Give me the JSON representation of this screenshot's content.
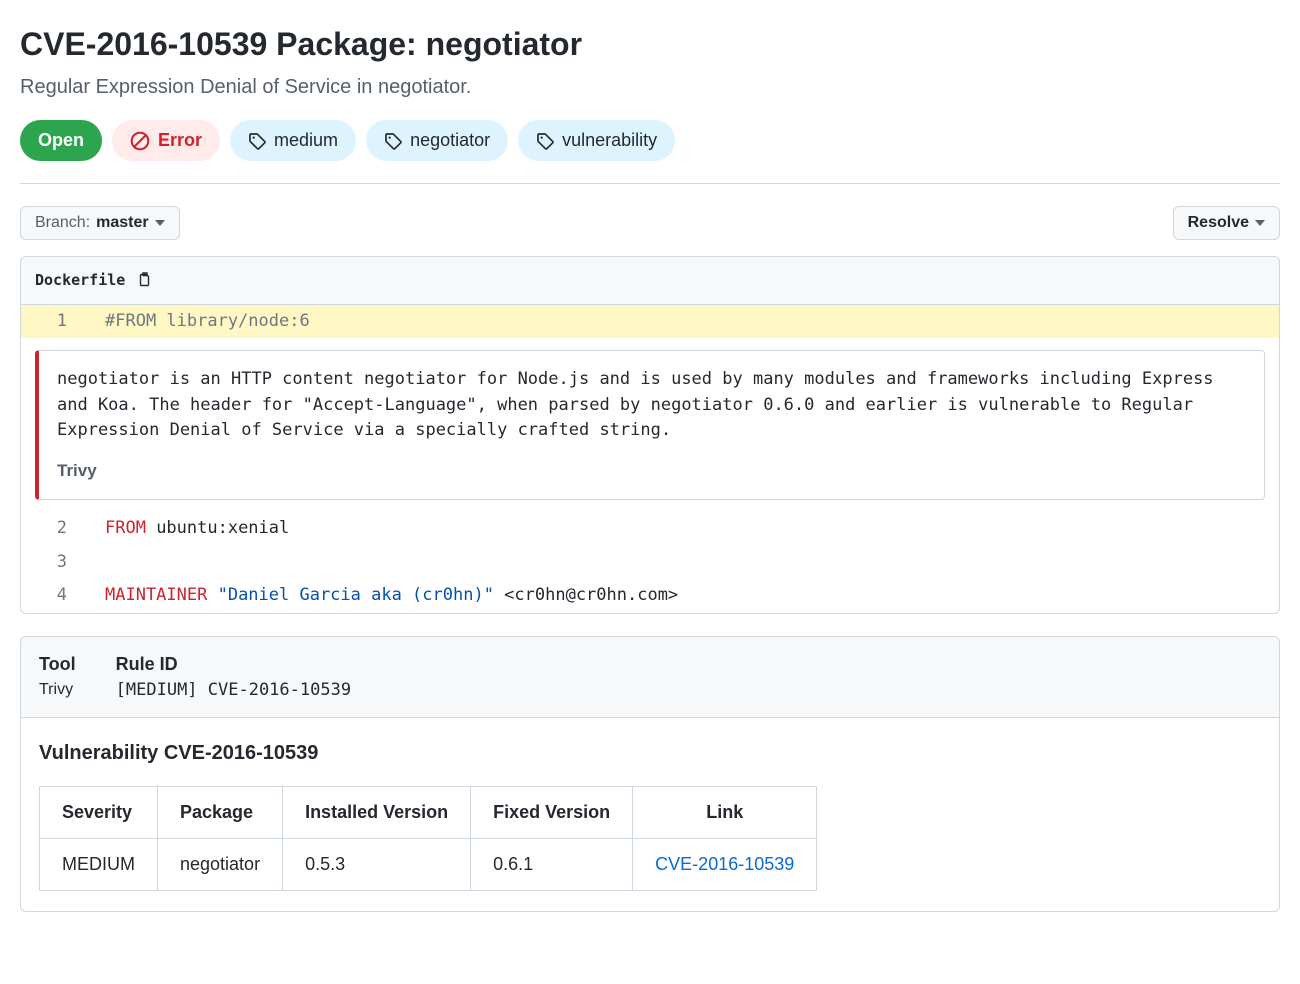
{
  "header": {
    "title": "CVE-2016-10539 Package: negotiator",
    "subtitle": "Regular Expression Denial of Service in negotiator."
  },
  "status": {
    "label": "Open"
  },
  "errorPill": {
    "label": "Error"
  },
  "tags": [
    {
      "label": "medium"
    },
    {
      "label": "negotiator"
    },
    {
      "label": "vulnerability"
    }
  ],
  "branch": {
    "prefix": "Branch:",
    "value": "master"
  },
  "resolve": {
    "label": "Resolve"
  },
  "file": {
    "name": "Dockerfile"
  },
  "codeLines": {
    "l1": {
      "num": "1",
      "comment": "#FROM library/node:6"
    },
    "l2": {
      "num": "2",
      "kw": "FROM",
      "rest": " ubuntu:xenial"
    },
    "l3": {
      "num": "3",
      "rest": ""
    },
    "l4": {
      "num": "4",
      "kw": "MAINTAINER",
      "str": " \"Daniel Garcia aka (cr0hn)\"",
      "rest": " <cr0hn@cr0hn.com>"
    }
  },
  "annotation": {
    "text": "negotiator is an HTTP content negotiator for Node.js and is used by many modules and frameworks including Express and Koa. The header for \"Accept-Language\", when parsed by negotiator 0.6.0 and earlier is vulnerable to Regular Expression Denial of Service via a specially crafted string.",
    "source": "Trivy"
  },
  "meta": {
    "toolLabel": "Tool",
    "toolValue": "Trivy",
    "ruleLabel": "Rule ID",
    "ruleValue": "[MEDIUM] CVE-2016-10539"
  },
  "vuln": {
    "title": "Vulnerability CVE-2016-10539",
    "headers": {
      "severity": "Severity",
      "package": "Package",
      "installed": "Installed Version",
      "fixed": "Fixed Version",
      "link": "Link"
    },
    "row": {
      "severity": "MEDIUM",
      "package": "negotiator",
      "installed": "0.5.3",
      "fixed": "0.6.1",
      "link": "CVE-2016-10539"
    }
  }
}
